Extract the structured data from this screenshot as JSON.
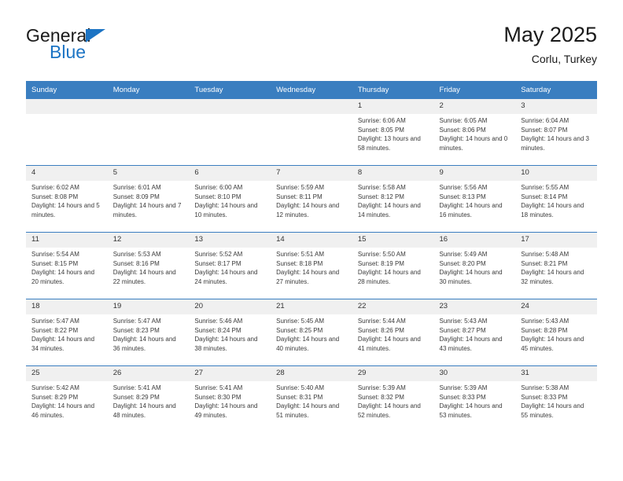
{
  "brand": {
    "line1": "General",
    "line2": "Blue",
    "triangle_color": "#1c74c4"
  },
  "header": {
    "title": "May 2025",
    "subtitle": "Corlu, Turkey"
  },
  "theme": {
    "header_blue": "#3a7ec0",
    "daynum_bg": "#f0f0f0",
    "text": "#3a3a3a"
  },
  "calendar": {
    "weekday_headers": [
      "Sunday",
      "Monday",
      "Tuesday",
      "Wednesday",
      "Thursday",
      "Friday",
      "Saturday"
    ],
    "labels": {
      "sunrise": "Sunrise:",
      "sunset": "Sunset:",
      "daylight": "Daylight:"
    },
    "weeks": [
      [
        {
          "day": "",
          "empty": true
        },
        {
          "day": "",
          "empty": true
        },
        {
          "day": "",
          "empty": true
        },
        {
          "day": "",
          "empty": true
        },
        {
          "day": "1",
          "sunrise": "Sunrise: 6:06 AM",
          "sunset": "Sunset: 8:05 PM",
          "daylight": "Daylight: 13 hours and 58 minutes."
        },
        {
          "day": "2",
          "sunrise": "Sunrise: 6:05 AM",
          "sunset": "Sunset: 8:06 PM",
          "daylight": "Daylight: 14 hours and 0 minutes."
        },
        {
          "day": "3",
          "sunrise": "Sunrise: 6:04 AM",
          "sunset": "Sunset: 8:07 PM",
          "daylight": "Daylight: 14 hours and 3 minutes."
        }
      ],
      [
        {
          "day": "4",
          "sunrise": "Sunrise: 6:02 AM",
          "sunset": "Sunset: 8:08 PM",
          "daylight": "Daylight: 14 hours and 5 minutes."
        },
        {
          "day": "5",
          "sunrise": "Sunrise: 6:01 AM",
          "sunset": "Sunset: 8:09 PM",
          "daylight": "Daylight: 14 hours and 7 minutes."
        },
        {
          "day": "6",
          "sunrise": "Sunrise: 6:00 AM",
          "sunset": "Sunset: 8:10 PM",
          "daylight": "Daylight: 14 hours and 10 minutes."
        },
        {
          "day": "7",
          "sunrise": "Sunrise: 5:59 AM",
          "sunset": "Sunset: 8:11 PM",
          "daylight": "Daylight: 14 hours and 12 minutes."
        },
        {
          "day": "8",
          "sunrise": "Sunrise: 5:58 AM",
          "sunset": "Sunset: 8:12 PM",
          "daylight": "Daylight: 14 hours and 14 minutes."
        },
        {
          "day": "9",
          "sunrise": "Sunrise: 5:56 AM",
          "sunset": "Sunset: 8:13 PM",
          "daylight": "Daylight: 14 hours and 16 minutes."
        },
        {
          "day": "10",
          "sunrise": "Sunrise: 5:55 AM",
          "sunset": "Sunset: 8:14 PM",
          "daylight": "Daylight: 14 hours and 18 minutes."
        }
      ],
      [
        {
          "day": "11",
          "sunrise": "Sunrise: 5:54 AM",
          "sunset": "Sunset: 8:15 PM",
          "daylight": "Daylight: 14 hours and 20 minutes."
        },
        {
          "day": "12",
          "sunrise": "Sunrise: 5:53 AM",
          "sunset": "Sunset: 8:16 PM",
          "daylight": "Daylight: 14 hours and 22 minutes."
        },
        {
          "day": "13",
          "sunrise": "Sunrise: 5:52 AM",
          "sunset": "Sunset: 8:17 PM",
          "daylight": "Daylight: 14 hours and 24 minutes."
        },
        {
          "day": "14",
          "sunrise": "Sunrise: 5:51 AM",
          "sunset": "Sunset: 8:18 PM",
          "daylight": "Daylight: 14 hours and 27 minutes."
        },
        {
          "day": "15",
          "sunrise": "Sunrise: 5:50 AM",
          "sunset": "Sunset: 8:19 PM",
          "daylight": "Daylight: 14 hours and 28 minutes."
        },
        {
          "day": "16",
          "sunrise": "Sunrise: 5:49 AM",
          "sunset": "Sunset: 8:20 PM",
          "daylight": "Daylight: 14 hours and 30 minutes."
        },
        {
          "day": "17",
          "sunrise": "Sunrise: 5:48 AM",
          "sunset": "Sunset: 8:21 PM",
          "daylight": "Daylight: 14 hours and 32 minutes."
        }
      ],
      [
        {
          "day": "18",
          "sunrise": "Sunrise: 5:47 AM",
          "sunset": "Sunset: 8:22 PM",
          "daylight": "Daylight: 14 hours and 34 minutes."
        },
        {
          "day": "19",
          "sunrise": "Sunrise: 5:47 AM",
          "sunset": "Sunset: 8:23 PM",
          "daylight": "Daylight: 14 hours and 36 minutes."
        },
        {
          "day": "20",
          "sunrise": "Sunrise: 5:46 AM",
          "sunset": "Sunset: 8:24 PM",
          "daylight": "Daylight: 14 hours and 38 minutes."
        },
        {
          "day": "21",
          "sunrise": "Sunrise: 5:45 AM",
          "sunset": "Sunset: 8:25 PM",
          "daylight": "Daylight: 14 hours and 40 minutes."
        },
        {
          "day": "22",
          "sunrise": "Sunrise: 5:44 AM",
          "sunset": "Sunset: 8:26 PM",
          "daylight": "Daylight: 14 hours and 41 minutes."
        },
        {
          "day": "23",
          "sunrise": "Sunrise: 5:43 AM",
          "sunset": "Sunset: 8:27 PM",
          "daylight": "Daylight: 14 hours and 43 minutes."
        },
        {
          "day": "24",
          "sunrise": "Sunrise: 5:43 AM",
          "sunset": "Sunset: 8:28 PM",
          "daylight": "Daylight: 14 hours and 45 minutes."
        }
      ],
      [
        {
          "day": "25",
          "sunrise": "Sunrise: 5:42 AM",
          "sunset": "Sunset: 8:29 PM",
          "daylight": "Daylight: 14 hours and 46 minutes."
        },
        {
          "day": "26",
          "sunrise": "Sunrise: 5:41 AM",
          "sunset": "Sunset: 8:29 PM",
          "daylight": "Daylight: 14 hours and 48 minutes."
        },
        {
          "day": "27",
          "sunrise": "Sunrise: 5:41 AM",
          "sunset": "Sunset: 8:30 PM",
          "daylight": "Daylight: 14 hours and 49 minutes."
        },
        {
          "day": "28",
          "sunrise": "Sunrise: 5:40 AM",
          "sunset": "Sunset: 8:31 PM",
          "daylight": "Daylight: 14 hours and 51 minutes."
        },
        {
          "day": "29",
          "sunrise": "Sunrise: 5:39 AM",
          "sunset": "Sunset: 8:32 PM",
          "daylight": "Daylight: 14 hours and 52 minutes."
        },
        {
          "day": "30",
          "sunrise": "Sunrise: 5:39 AM",
          "sunset": "Sunset: 8:33 PM",
          "daylight": "Daylight: 14 hours and 53 minutes."
        },
        {
          "day": "31",
          "sunrise": "Sunrise: 5:38 AM",
          "sunset": "Sunset: 8:33 PM",
          "daylight": "Daylight: 14 hours and 55 minutes."
        }
      ]
    ]
  }
}
